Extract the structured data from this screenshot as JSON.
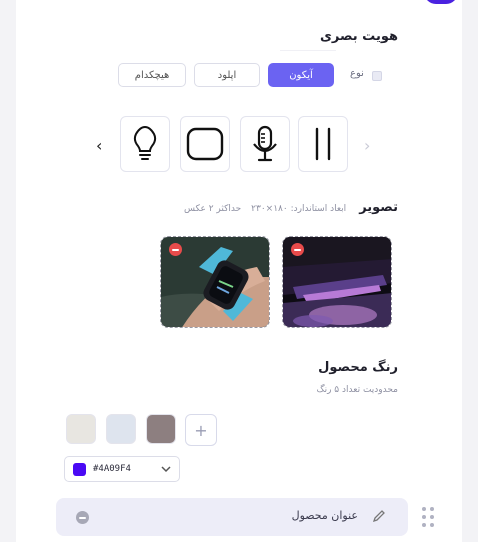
{
  "section": {
    "visual_identity_title": "هویت بصری"
  },
  "type": {
    "label": "نوع",
    "options": [
      "آیکون",
      "اپلود",
      "هیچکدام"
    ],
    "selected": "آیکون"
  },
  "icons": {
    "items": [
      "pause-icon",
      "microphone-icon",
      "rounded-square-icon",
      "lightbulb-icon"
    ],
    "prev": "›",
    "next": "‹"
  },
  "image": {
    "title": "تصویر",
    "max_count": "حداکثر ۲ عکس",
    "dimensions": "ابعاد استاندارد: ۱۸۰×۲۳۰"
  },
  "color": {
    "title": "رنگ محصول",
    "limit": "محدودیت تعداد ۵ رنگ",
    "swatches": [
      "#E8E6E1",
      "#DEE4EE",
      "#8D7F80"
    ],
    "add": "+",
    "selected_hex": "#4A09F4"
  },
  "product_title": {
    "label": "عنوان محصول"
  },
  "accent": "#6B63F2"
}
